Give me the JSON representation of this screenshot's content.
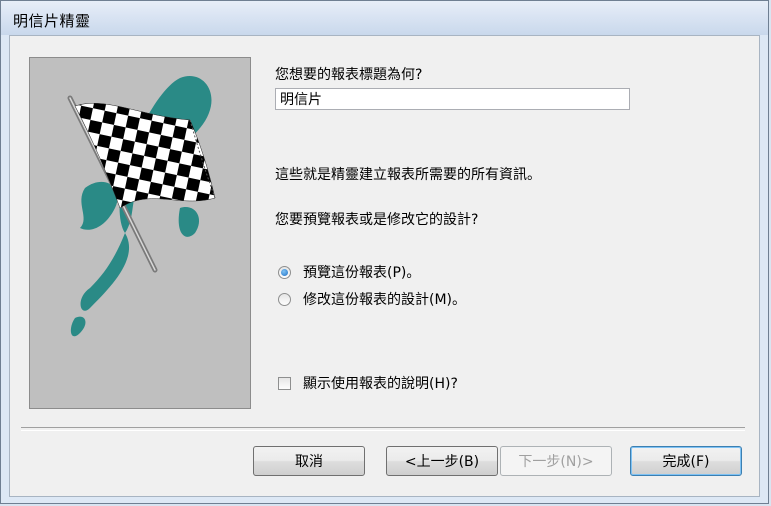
{
  "window": {
    "title": "明信片精靈"
  },
  "prompt_title": "您想要的報表標題為何?",
  "title_input": {
    "value": "明信片"
  },
  "info_text": "這些就是精靈建立報表所需要的所有資訊。",
  "question_text": "您要預覽報表或是修改它的設計?",
  "options": [
    {
      "label": "預覽這份報表(P)。",
      "checked": true
    },
    {
      "label": "修改這份報表的設計(M)。",
      "checked": false
    }
  ],
  "help_checkbox": {
    "label": "顯示使用報表的說明(H)?",
    "checked": false
  },
  "buttons": {
    "cancel": "取消",
    "back": "<上一步(B)",
    "next": "下一步(N)>",
    "finish": "完成(F)"
  },
  "colors": {
    "flag_teal": "#2a8a86",
    "radio_selected": "#1f6fc4"
  }
}
